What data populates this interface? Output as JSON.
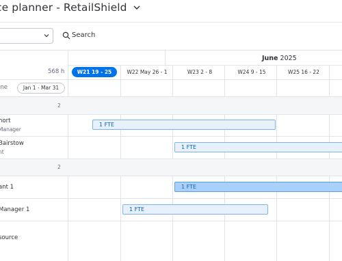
{
  "header": {
    "title": "ce planner - RetailShield",
    "search_label": "Search"
  },
  "timeline": {
    "month_label": "June",
    "year_label": "2025",
    "total_hours": "568 h",
    "weeks": [
      {
        "label": "W21 19 - 25",
        "active": true
      },
      {
        "label": "W22 May 26 - 1",
        "active": false
      },
      {
        "label": "W23 2 - 8",
        "active": false
      },
      {
        "label": "W24 9 - 15",
        "active": false
      },
      {
        "label": "W25 16 - 22",
        "active": false
      }
    ]
  },
  "sidebar": {
    "timeline_label": "ine",
    "date_range": "Jan 1 - Mar 31",
    "groups": [
      {
        "count": "2"
      },
      {
        "count": "2"
      }
    ],
    "rows": [
      {
        "name": "hort",
        "role": "Manager"
      },
      {
        "name": "Bairstow",
        "role": "nt"
      },
      {
        "name": "ant 1",
        "role": ""
      },
      {
        "name": "Manager 1",
        "role": ""
      },
      {
        "name": "source",
        "role": ""
      }
    ]
  },
  "allocations": [
    {
      "label": "1 FTE"
    },
    {
      "label": "1 FTE"
    },
    {
      "label": "1 FTE"
    },
    {
      "label": "1 FTE"
    }
  ],
  "colors": {
    "accent": "#0073ea",
    "bar_light": "#e6f1fd",
    "bar_strong": "#a9cffb",
    "group_band": "#f5f6f8"
  }
}
